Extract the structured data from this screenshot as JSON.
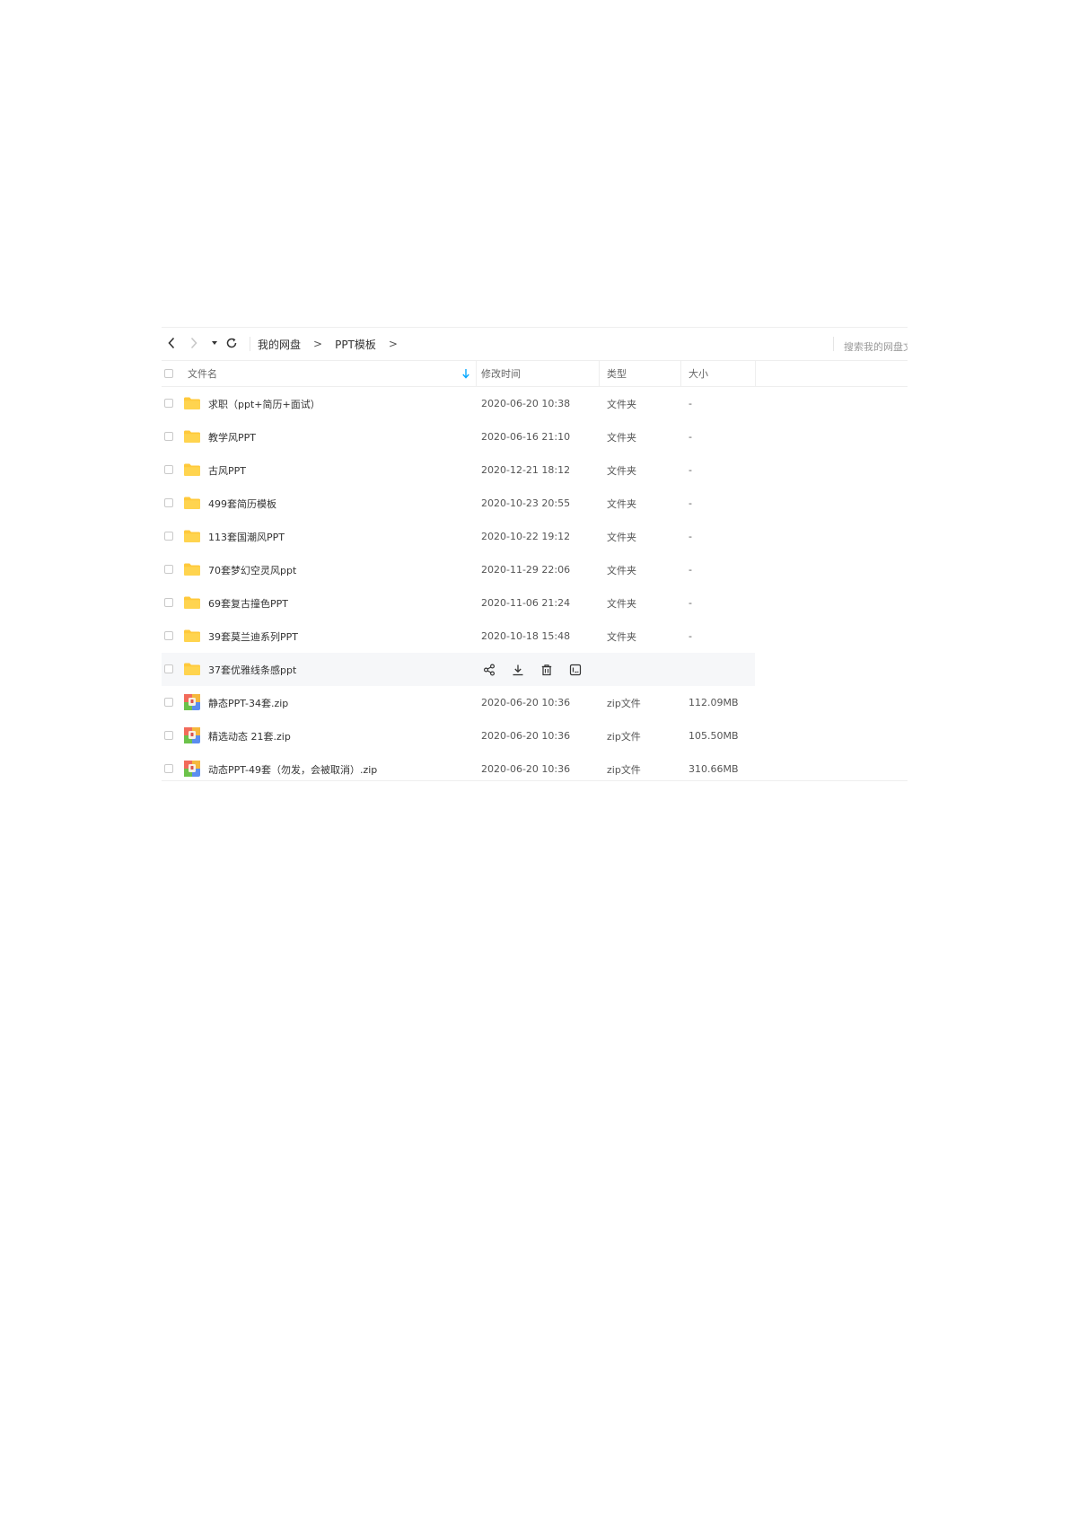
{
  "breadcrumb": {
    "root": "我的网盘",
    "separator": ">",
    "current": "PPT模板",
    "trailing": ">"
  },
  "search": {
    "placeholder": "搜索我的网盘文件"
  },
  "columns": {
    "name": "文件名",
    "modified": "修改时间",
    "type": "类型",
    "size": "大小"
  },
  "icons": {
    "back": "chevron-left-icon",
    "forward": "chevron-right-icon",
    "history": "caret-down-icon",
    "refresh": "refresh-icon",
    "sort": "sort-down-arrow-icon",
    "folder": "folder-icon",
    "zip": "zip-archive-icon",
    "share": "share-icon",
    "download": "download-icon",
    "delete": "trash-icon",
    "more": "more-icon"
  },
  "colors": {
    "folder": "#FFC93B",
    "sort_accent": "#06A7FF",
    "hover_row": "#F6F7F9"
  },
  "files": [
    {
      "name": "求职（ppt+简历+面试）",
      "modified": "2020-06-20 10:38",
      "type": "文件夹",
      "size": "-",
      "kind": "folder"
    },
    {
      "name": "教学风PPT",
      "modified": "2020-06-16 21:10",
      "type": "文件夹",
      "size": "-",
      "kind": "folder"
    },
    {
      "name": "古风PPT",
      "modified": "2020-12-21 18:12",
      "type": "文件夹",
      "size": "-",
      "kind": "folder"
    },
    {
      "name": "499套简历模板",
      "modified": "2020-10-23 20:55",
      "type": "文件夹",
      "size": "-",
      "kind": "folder"
    },
    {
      "name": "113套国潮风PPT",
      "modified": "2020-10-22 19:12",
      "type": "文件夹",
      "size": "-",
      "kind": "folder"
    },
    {
      "name": "70套梦幻空灵风ppt",
      "modified": "2020-11-29 22:06",
      "type": "文件夹",
      "size": "-",
      "kind": "folder"
    },
    {
      "name": "69套复古撞色PPT",
      "modified": "2020-11-06 21:24",
      "type": "文件夹",
      "size": "-",
      "kind": "folder"
    },
    {
      "name": "39套莫兰迪系列PPT",
      "modified": "2020-10-18 15:48",
      "type": "文件夹",
      "size": "-",
      "kind": "folder"
    },
    {
      "name": "37套优雅线条感ppt",
      "modified": "",
      "type": "",
      "size": "",
      "kind": "folder",
      "hover": true
    },
    {
      "name": "静态PPT-34套.zip",
      "modified": "2020-06-20 10:36",
      "type": "zip文件",
      "size": "112.09MB",
      "kind": "zip"
    },
    {
      "name": "精选动态 21套.zip",
      "modified": "2020-06-20 10:36",
      "type": "zip文件",
      "size": "105.50MB",
      "kind": "zip"
    },
    {
      "name": "动态PPT-49套（勿发，会被取消）.zip",
      "modified": "2020-06-20 10:36",
      "type": "zip文件",
      "size": "310.66MB",
      "kind": "zip"
    }
  ]
}
